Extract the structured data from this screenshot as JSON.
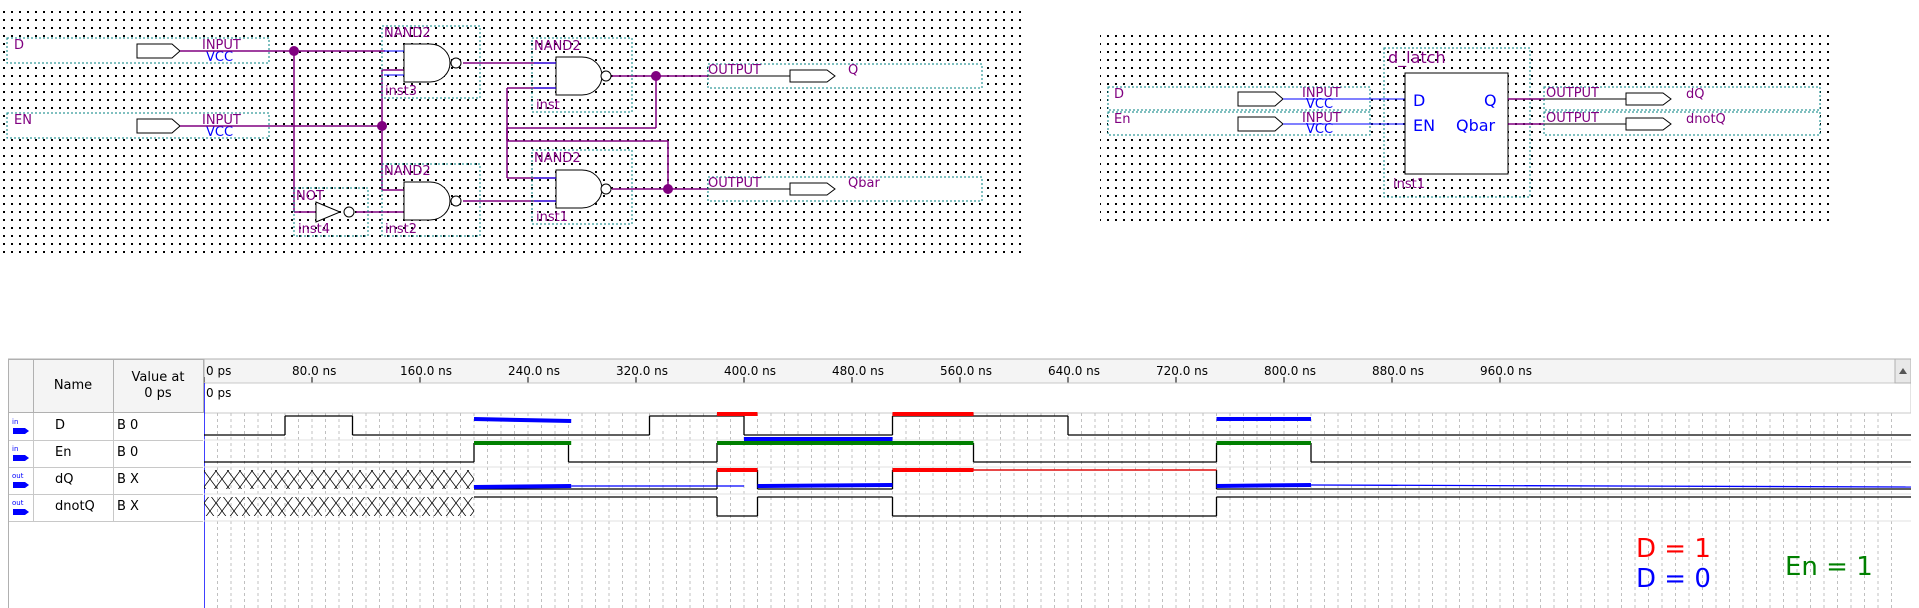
{
  "schematic1": {
    "pins": {
      "d_name": "D",
      "en_name": "EN",
      "input_type": "INPUT",
      "vcc": "VCC",
      "output_type": "OUTPUT",
      "q_name": "Q",
      "qbar_name": "Qbar"
    },
    "gates": {
      "nand_type": "NAND2",
      "not_type": "NOT",
      "inst3": "inst3",
      "inst": "inst",
      "inst2": "inst2",
      "inst1": "inst1",
      "inst4": "inst4"
    }
  },
  "schematic2": {
    "block_name": "d_latch",
    "block_inst": "inst1",
    "port_d": "D",
    "port_en": "EN",
    "port_q": "Q",
    "port_qbar": "Qbar",
    "pin_d": "D",
    "pin_en": "En",
    "input_type": "INPUT",
    "vcc": "VCC",
    "output_type": "OUTPUT",
    "out_dq": "dQ",
    "out_dnotq": "dnotQ"
  },
  "waveform": {
    "headers": {
      "name": "Name",
      "value_at_line1": "Value at",
      "value_at_line2": "0 ps"
    },
    "cursor_label": "0 ps",
    "time_labels": [
      "0 ps",
      "80.0 ns",
      "160.0 ns",
      "240.0 ns",
      "320.0 ns",
      "400.0 ns",
      "480.0 ns",
      "560.0 ns",
      "640.0 ns",
      "720.0 ns",
      "800.0 ns",
      "880.0 ns",
      "960.0 ns"
    ],
    "signals": [
      {
        "dir": "in",
        "name": "D",
        "value": "B 0"
      },
      {
        "dir": "in",
        "name": "En",
        "value": "B 0"
      },
      {
        "dir": "out",
        "name": "dQ",
        "value": "B X"
      },
      {
        "dir": "out",
        "name": "dnotQ",
        "value": "B X"
      }
    ],
    "colors": {
      "red": "#ff0000",
      "blue": "#0000ff",
      "green": "#008000",
      "wire": "#800080",
      "label": "#800080",
      "vcc": "#0000ff"
    }
  },
  "legend": {
    "d1": "D = 1",
    "d0": "D = 0",
    "en1": "En = 1"
  }
}
